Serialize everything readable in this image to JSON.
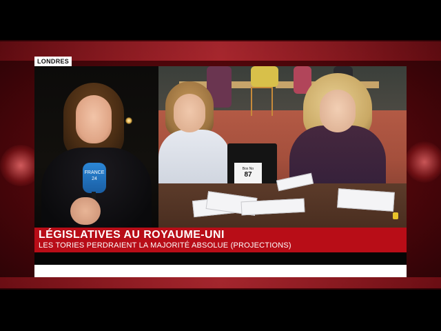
{
  "location_tag": "LONDRES",
  "headline": "LÉGISLATIVES AU ROYAUME-UNI",
  "subheadline": "LES TORIES PERDRAIENT LA MAJORITÉ ABSOLUE (PROJECTIONS)",
  "ballot_box": {
    "caption": "Box No",
    "number": "87"
  },
  "mic_label": "FRANCE 24",
  "colors": {
    "brand_red": "#b80d17",
    "background_red": "#8a0d14",
    "mic_blue": "#2b86d6"
  }
}
